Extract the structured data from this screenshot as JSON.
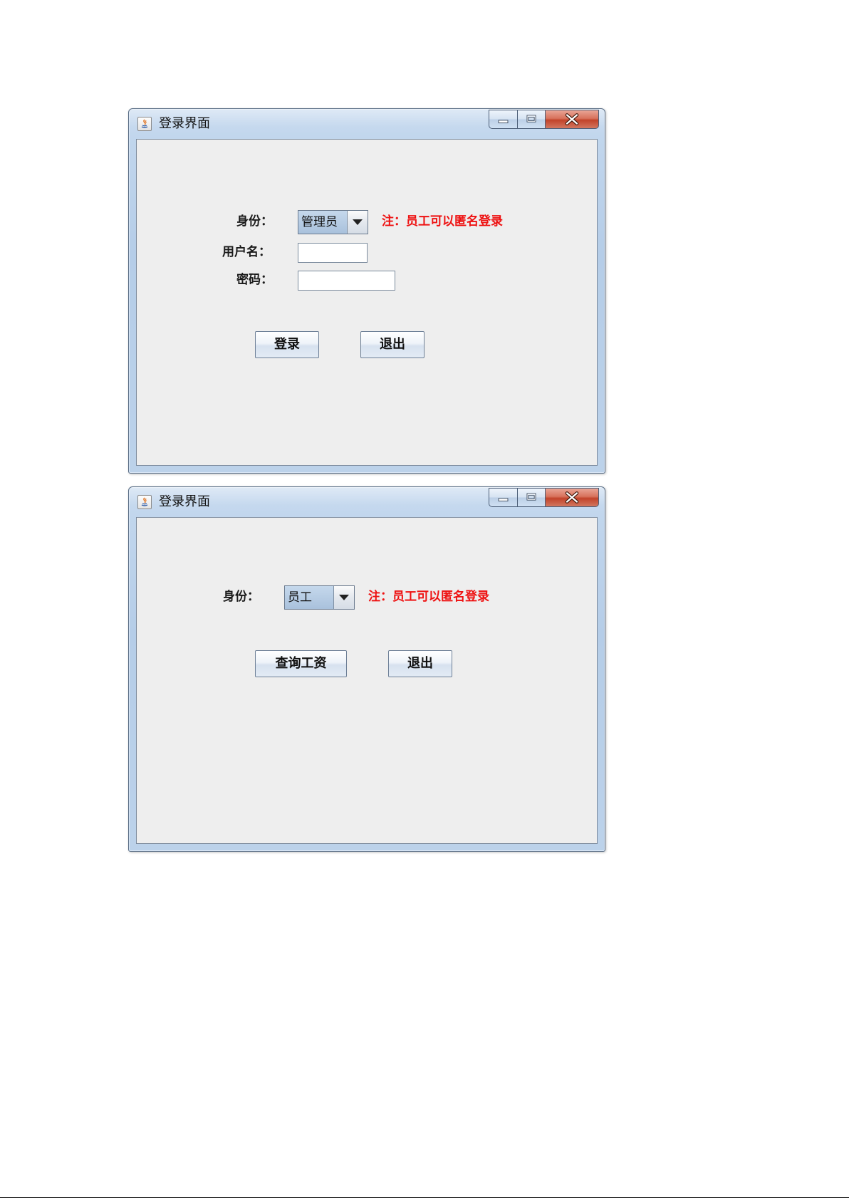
{
  "windows": [
    {
      "title": "登录界面",
      "identity_label": "身份：",
      "identity_value": "管理员",
      "note": "注：员工可以匿名登录",
      "username_label": "用户名：",
      "username_value": "",
      "password_label": "密码：",
      "password_value": "",
      "login_button": "登录",
      "exit_button": "退出"
    },
    {
      "title": "登录界面",
      "identity_label": "身份：",
      "identity_value": "员工",
      "note": "注：员工可以匿名登录",
      "query_button": "查询工资",
      "exit_button": "退出"
    }
  ],
  "icons": {
    "app": "java-app-icon",
    "minimize": "minimize-icon",
    "maximize": "maximize-icon",
    "close": "close-icon",
    "dropdown": "dropdown-arrow-icon"
  },
  "colors": {
    "note_text": "#ee1111",
    "client_bg": "#eeeeee",
    "close_button": "#c2432a"
  }
}
